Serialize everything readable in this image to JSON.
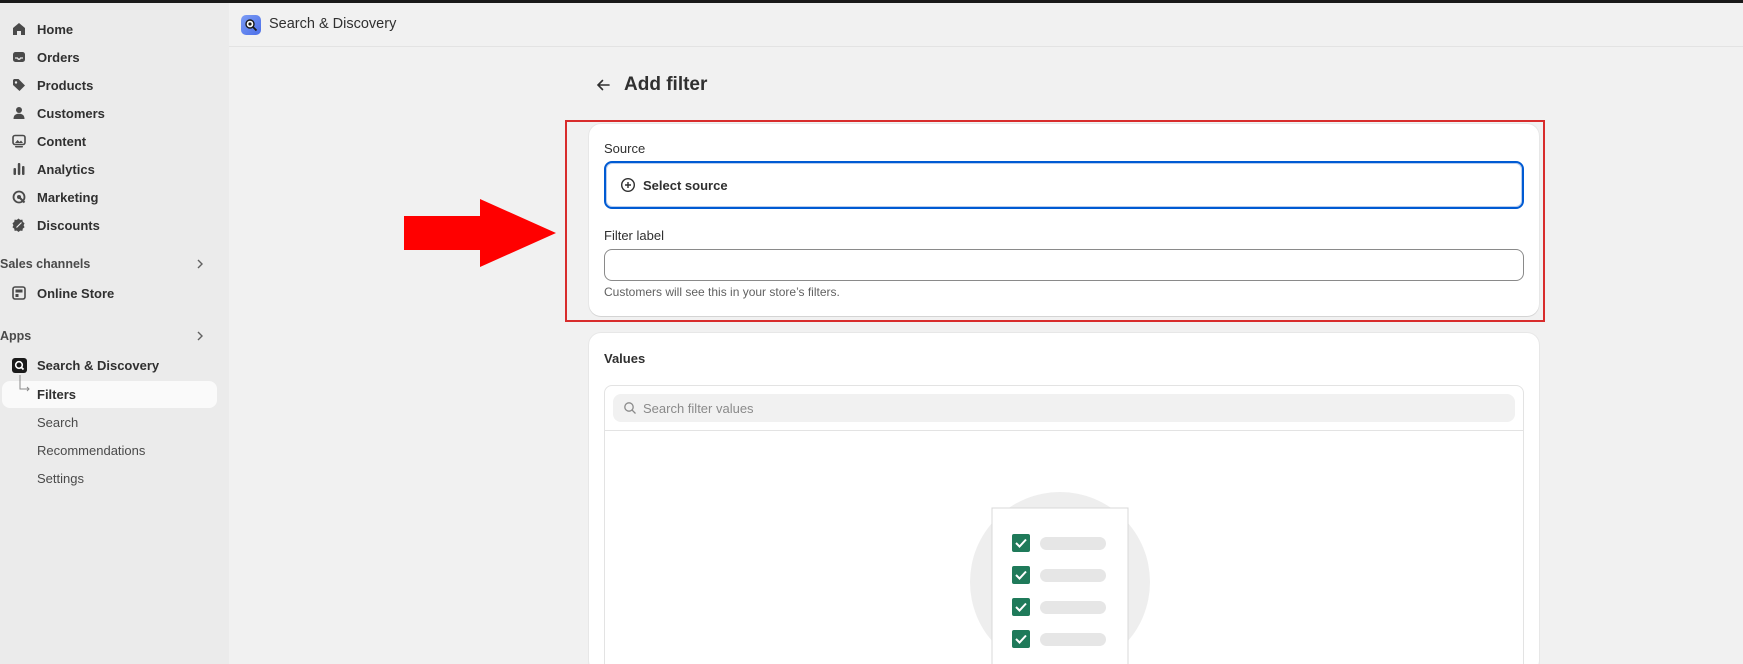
{
  "sidebar": {
    "nav": [
      {
        "label": "Home",
        "icon": "home-icon"
      },
      {
        "label": "Orders",
        "icon": "inbox-icon"
      },
      {
        "label": "Products",
        "icon": "tag-icon"
      },
      {
        "label": "Customers",
        "icon": "person-icon"
      },
      {
        "label": "Content",
        "icon": "image-icon"
      },
      {
        "label": "Analytics",
        "icon": "bar-chart-icon"
      },
      {
        "label": "Marketing",
        "icon": "target-icon"
      },
      {
        "label": "Discounts",
        "icon": "discount-icon"
      }
    ],
    "sales_channels": {
      "heading": "Sales channels",
      "items": [
        {
          "label": "Online Store",
          "icon": "store-icon"
        }
      ]
    },
    "apps": {
      "heading": "Apps",
      "app_name": "Search & Discovery",
      "subitems": [
        {
          "label": "Filters",
          "active": true
        },
        {
          "label": "Search"
        },
        {
          "label": "Recommendations"
        },
        {
          "label": "Settings"
        }
      ]
    }
  },
  "header": {
    "app_title": "Search & Discovery"
  },
  "page": {
    "title": "Add filter"
  },
  "source_card": {
    "source_label": "Source",
    "select_source_label": "Select source",
    "filter_label_label": "Filter label",
    "filter_label_value": "",
    "help_text": "Customers will see this in your store’s filters."
  },
  "values_card": {
    "title": "Values",
    "search_placeholder": "Search filter values"
  },
  "colors": {
    "accent": "#005bd3",
    "highlight": "#d82c2c",
    "check": "#1f7a5a",
    "arrow": "#ff0000"
  }
}
